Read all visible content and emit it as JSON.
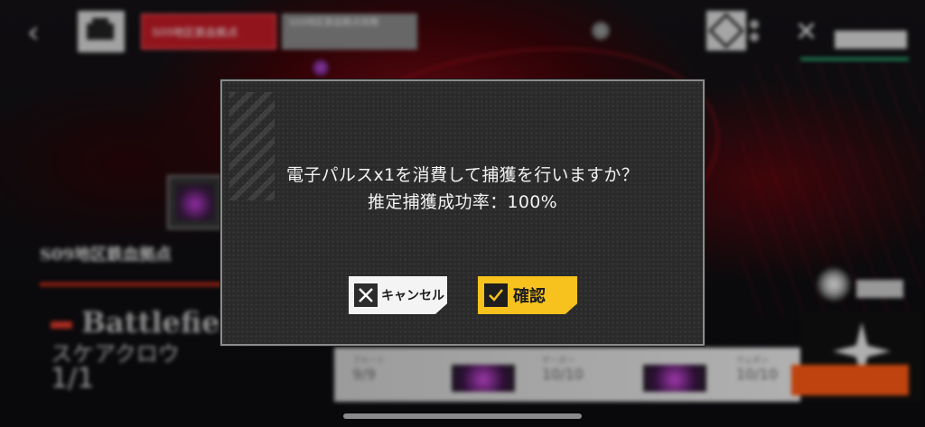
{
  "topbar": {
    "back_icon": "chevron-left-icon",
    "home_icon": "base-icon",
    "region_label": "S09地区鉄血拠点",
    "region_sub_label": "S09地区鉄血拠点攻略"
  },
  "left_panel": {
    "title": "S09地区鉄血拠点",
    "big_text": "Battlefield",
    "jp_text": "スケアクロウ",
    "count": "1/1"
  },
  "slots": [
    {
      "label": "ブルート",
      "count": "9/9"
    },
    {
      "label": "ゲーガー",
      "count": "10/10"
    },
    {
      "label": "ウェポン",
      "count": "10/10"
    }
  ],
  "dialog": {
    "message_line1": "電子パルスx1を消費して捕獲を行いますか？",
    "message_line2": "推定捕獲成功率：100%",
    "cancel_label": "キャンセル",
    "confirm_label": "確認"
  },
  "colors": {
    "dialog_bg": "#2a2a2a",
    "dialog_border": "#8b8b8b",
    "confirm_bg": "#f7c21e",
    "cancel_bg": "#f4f4f4",
    "region_tag": "#c21a26",
    "accent_orange": "#ff5a14"
  }
}
